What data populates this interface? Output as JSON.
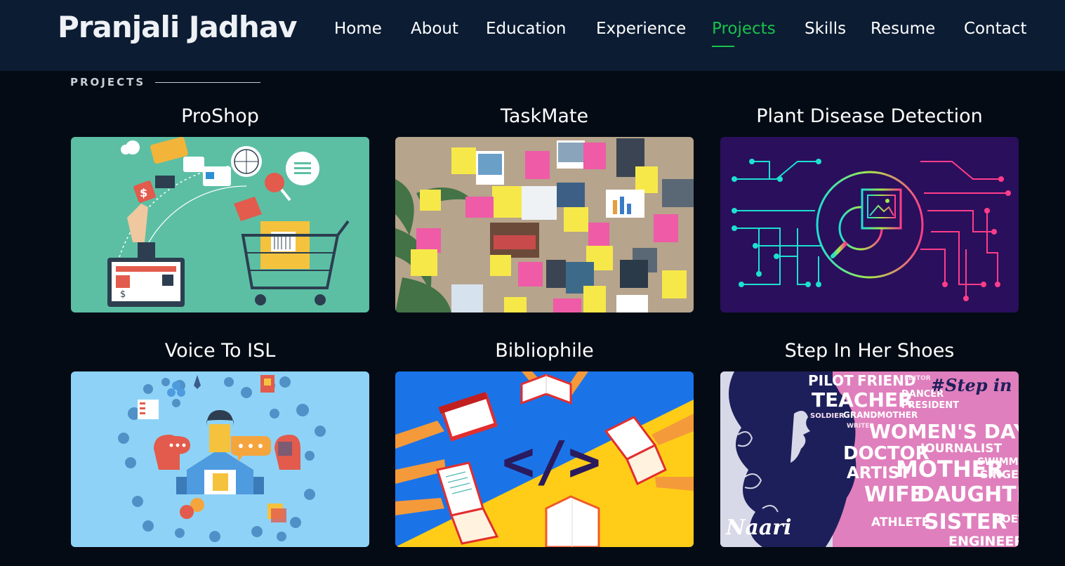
{
  "header": {
    "logo": "Pranjali Jadhav",
    "nav": [
      {
        "label": "Home",
        "active": false
      },
      {
        "label": "About",
        "active": false
      },
      {
        "label": "Education",
        "active": false
      },
      {
        "label": "Experience",
        "active": false
      },
      {
        "label": "Projects",
        "active": true
      },
      {
        "label": "Skills",
        "active": false
      },
      {
        "label": "Resume",
        "active": false
      },
      {
        "label": "Contact",
        "active": false
      }
    ]
  },
  "section": {
    "label": "PROJECTS"
  },
  "projects": [
    {
      "title": "ProShop",
      "image": "online-shopping-illustration"
    },
    {
      "title": "TaskMate",
      "image": "sticky-notes-board-photo"
    },
    {
      "title": "Plant Disease Detection",
      "image": "circuit-image-search-illustration"
    },
    {
      "title": "Voice To ISL",
      "image": "communication-icons-illustration"
    },
    {
      "title": "Bibliophile",
      "image": "books-and-code-illustration"
    },
    {
      "title": "Step In Her Shoes",
      "image": "women-profession-word-cloud"
    }
  ],
  "word_art": {
    "words": [
      "PILOT",
      "FRIEND",
      "EDITOR",
      "TEACHER",
      "DANCER",
      "PRESIDENT",
      "SOLDIER",
      "GRANDMOTHER",
      "WRITER",
      "WOMEN'S DAY",
      "DOCTOR",
      "JOURNALIST",
      "ARTIST",
      "MOTHER",
      "SWIMMER",
      "SINGER",
      "WIFE",
      "DAUGHTER",
      "ATHLETE",
      "SISTER",
      "POET",
      "ENGINEER"
    ],
    "signature": "Naari",
    "hashtag": "#Step in her Shoes"
  },
  "colors": {
    "header_bg": "#0b1c33",
    "page_bg": "#040b14",
    "accent": "#18c34a"
  }
}
